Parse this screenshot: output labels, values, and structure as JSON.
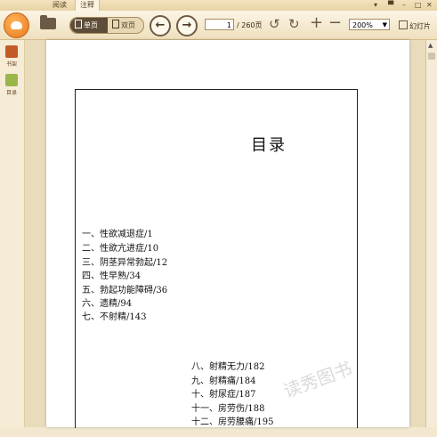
{
  "tabs": [
    {
      "label": "阅读"
    },
    {
      "label": "注释"
    }
  ],
  "window_controls": [
    "minimize-icon",
    "restore-icon",
    "close-icon"
  ],
  "toolbar": {
    "single_page_label": "单页",
    "double_page_label": "双页",
    "current_page": "1",
    "total_pages_label": "/ 260页",
    "zoom_value": "200%",
    "slideshow_label": "幻灯片"
  },
  "sidebar": {
    "items": [
      {
        "label": "书架",
        "icon": "bookshelf-icon"
      },
      {
        "label": "目录",
        "icon": "toc-icon"
      }
    ]
  },
  "document": {
    "title": "目录",
    "entries": [
      "一、性欲减退症/1",
      "二、性欲亢进症/10",
      "三、阴茎异常勃起/12",
      "四、性早熟/34",
      "五、勃起功能障碍/36",
      "六、遗精/94",
      "七、不射精/143",
      "八、射精无力/182",
      "九、射精痛/184",
      "十、射尿症/187",
      "十一、房劳伤/188",
      "十二、房劳腰痛/195"
    ],
    "watermark_text": "读秀图书"
  },
  "colors": {
    "accent": "#e8771c",
    "toolbar_bg": "#f3e8cf",
    "button_dark": "#5d4c38"
  }
}
